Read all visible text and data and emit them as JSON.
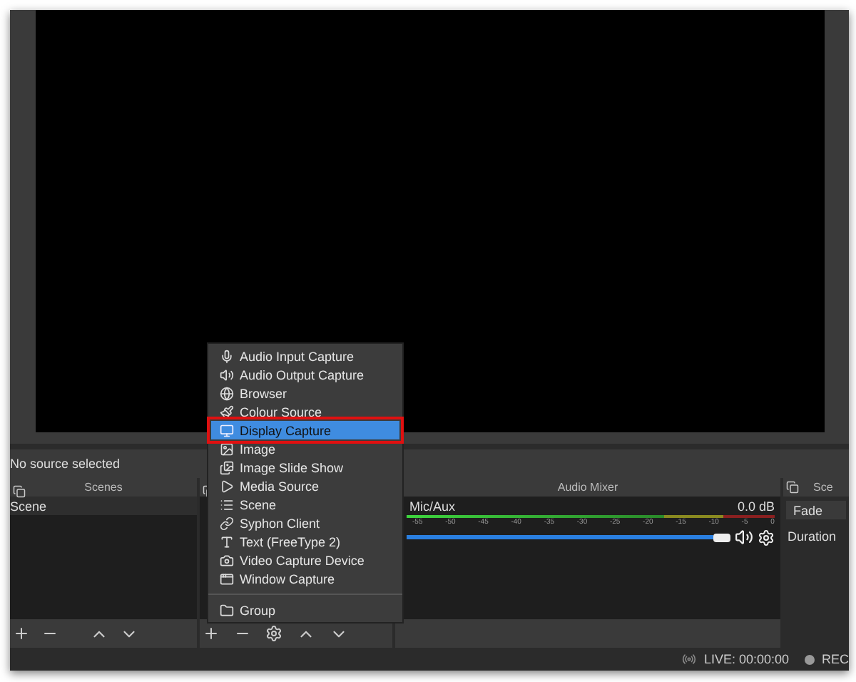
{
  "toolbar": {
    "status": "No source selected"
  },
  "scenes": {
    "title": "Scenes",
    "items": [
      {
        "label": "Scene",
        "selected": false
      }
    ]
  },
  "audio_mixer": {
    "title": "Audio Mixer",
    "channel": {
      "name": "Mic/Aux",
      "reading": "0.0 dB",
      "level": 1,
      "ticks": [
        "-55",
        "-50",
        "-45",
        "-40",
        "-35",
        "-30",
        "-25",
        "-20",
        "-15",
        "-10",
        "-5",
        "0"
      ]
    }
  },
  "transitions": {
    "title": "Sce",
    "mode": "Fade",
    "duration_label": "Duration"
  },
  "menu": [
    {
      "label": "Audio Input Capture",
      "selected": false
    },
    {
      "label": "Audio Output Capture",
      "selected": false
    },
    {
      "label": "Browser",
      "selected": false
    },
    {
      "label": "Colour Source",
      "selected": false
    },
    {
      "label": "Display Capture",
      "selected": true
    },
    {
      "label": "Image",
      "selected": false
    },
    {
      "label": "Image Slide Show",
      "selected": false
    },
    {
      "label": "Media Source",
      "selected": false
    },
    {
      "label": "Scene",
      "selected": false
    },
    {
      "label": "Syphon Client",
      "selected": false
    },
    {
      "label": "Text (FreeType 2)",
      "selected": false
    },
    {
      "label": "Video Capture Device",
      "selected": false
    },
    {
      "label": "Window Capture",
      "selected": false
    },
    {
      "label": "Group",
      "selected": false,
      "separated": true
    }
  ],
  "status_bar": {
    "live": "LIVE: 00:00:00",
    "rec": "REC"
  }
}
